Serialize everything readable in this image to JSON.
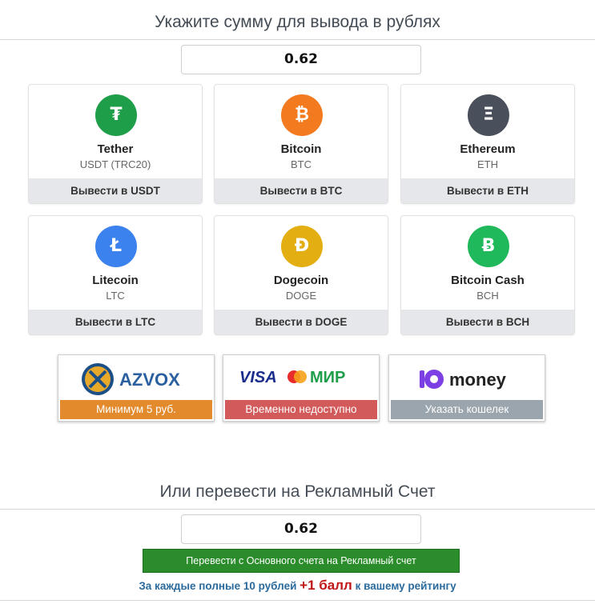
{
  "withdraw": {
    "title": "Укажите сумму для вывода в рублях",
    "amount": "0.62"
  },
  "coins": [
    {
      "name": "Tether",
      "ticker": "USDT (TRC20)",
      "button": "Вывести в USDT",
      "symbol": "₮",
      "color": "#1f9e4a"
    },
    {
      "name": "Bitcoin",
      "ticker": "BTC",
      "button": "Вывести в BTC",
      "symbol": "₿",
      "color": "#f37a1f"
    },
    {
      "name": "Ethereum",
      "ticker": "ETH",
      "button": "Вывести в ETH",
      "symbol": "Ξ",
      "color": "#4a4f5c"
    },
    {
      "name": "Litecoin",
      "ticker": "LTC",
      "button": "Вывести в LTC",
      "symbol": "Ł",
      "color": "#3b82ee"
    },
    {
      "name": "Dogecoin",
      "ticker": "DOGE",
      "button": "Вывести в DOGE",
      "symbol": "Đ",
      "color": "#e2ae12"
    },
    {
      "name": "Bitcoin Cash",
      "ticker": "BCH",
      "button": "Вывести в BCH",
      "symbol": "Ƀ",
      "color": "#1fb85a"
    }
  ],
  "payments": [
    {
      "logo": "AZVOX",
      "status": "Минимум 5 руб.",
      "color": "#e38a2c"
    },
    {
      "logo": "VISA МИР",
      "status": "Временно недоступно",
      "color": "#d25a5a"
    },
    {
      "logo": "money",
      "status": "Указать кошелек",
      "color": "#9aa5ad"
    }
  ],
  "ad_account": {
    "title": "Или перевести на Рекламный Счет",
    "amount": "0.62",
    "transfer_button": "Перевести с Основного счета на Рекламный счет",
    "bonus_prefix": "За каждые полные 10 рублей",
    "bonus_highlight": "+1 балл",
    "bonus_suffix": "к вашему рейтингу"
  }
}
